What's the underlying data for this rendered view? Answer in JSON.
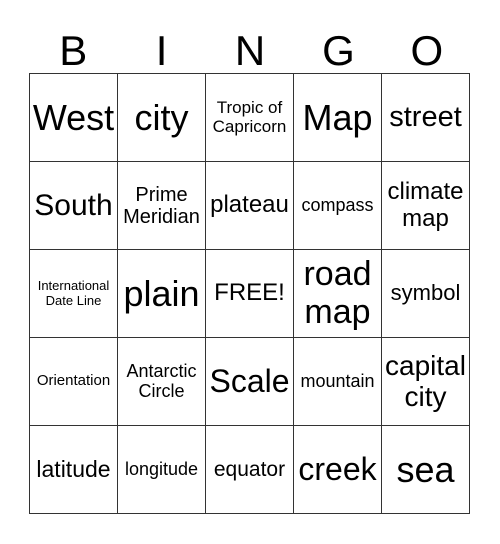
{
  "header": [
    "B",
    "I",
    "N",
    "G",
    "O"
  ],
  "cells": [
    [
      "West",
      "city",
      "Tropic of Capricorn",
      "Map",
      "street"
    ],
    [
      "South",
      "Prime Meridian",
      "plateau",
      "compass",
      "climate map"
    ],
    [
      "International Date Line",
      "plain",
      "FREE!",
      "road map",
      "symbol"
    ],
    [
      "Orientation",
      "Antarctic Circle",
      "Scale",
      "mountain",
      "capital city"
    ],
    [
      "latitude",
      "longitude",
      "equator",
      "creek",
      "sea"
    ]
  ]
}
